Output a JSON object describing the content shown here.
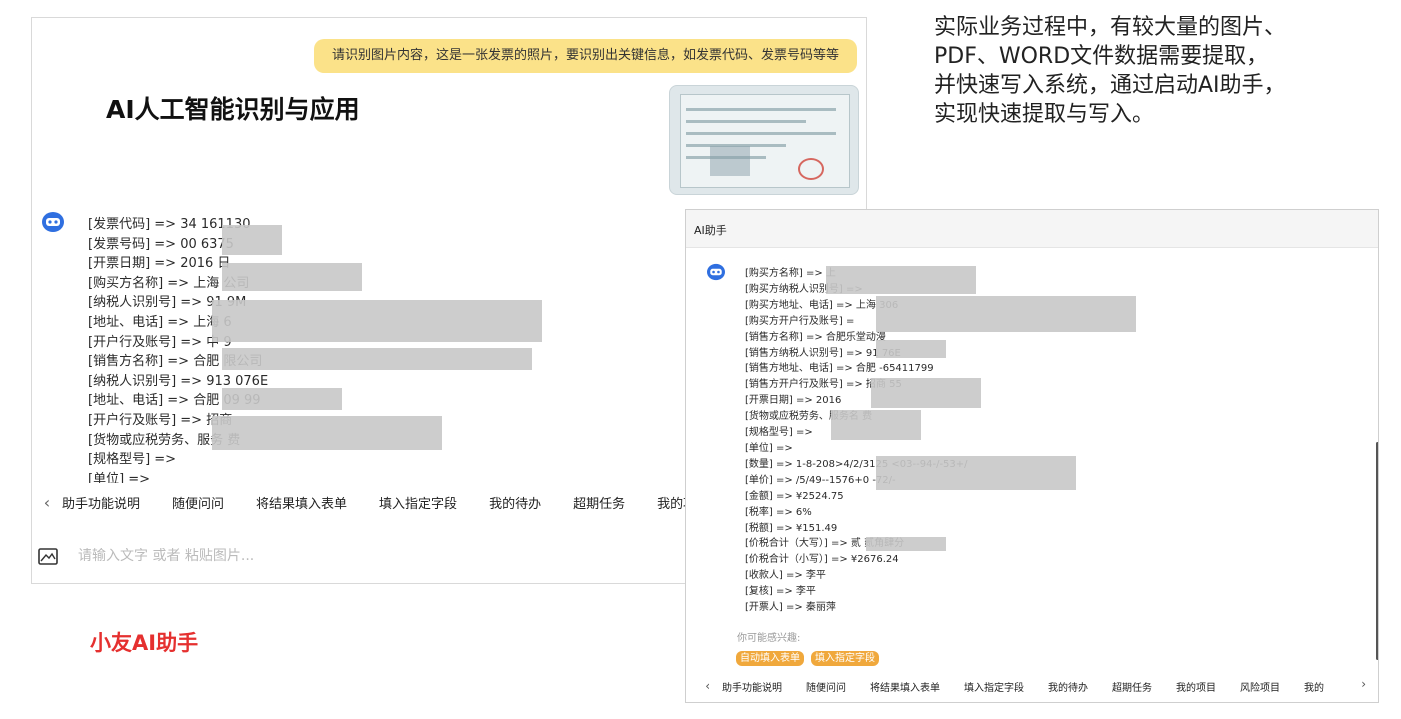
{
  "left_panel": {
    "user_message": "请识别图片内容，这是一张发票的照片，要识别出关键信息，如发票代码、发票号码等等",
    "title": "AI人工智能识别与应用",
    "avatar_icon": "robot-avatar-icon",
    "result_lines": [
      "[发票代码] => 34  161130",
      "[发票号码] => 00      6375",
      "[开票日期] => 2016         日",
      "[购买方名称] => 上海                         公司",
      "[纳税人识别号] => 91                          9M",
      "[地址、电话] => 上海                                                  6",
      "[开户行及账号] => 中                                                     9",
      "[销售方名称] => 合肥                        限公司",
      "[纳税人识别号] => 913                  076E",
      "[地址、电话] => 合肥                          09          99",
      "[开户行及账号] => 招商",
      "[货物或应税劳务、服务                     费",
      "[规格型号] =>",
      "[单位] =>"
    ],
    "chips": [
      "助手功能说明",
      "随便问问",
      "将结果填入表单",
      "填入指定字段",
      "我的待办",
      "超期任务",
      "我的项目"
    ],
    "input_placeholder": "请输入文字 或者 粘贴图片...",
    "caption": "小友AI助手"
  },
  "description": {
    "lines": [
      "实际业务过程中，有较大量的图片、",
      "PDF、WORD文件数据需要提取，",
      "并快速写入系统，通过启动AI助手，",
      "实现快速提取与写入。"
    ]
  },
  "right_panel": {
    "title": "AI助手",
    "avatar_icon": "robot-avatar-icon",
    "result_lines": [
      "[购买方名称] => 上",
      "[购买方纳税人识别号] =>",
      "[购买方地址、电话] => 上海                                                              306",
      "[购买方开户行及账号] =",
      "[销售方名称] => 合肥乐堂动漫",
      "[销售方纳税人识别号] => 91                            76E",
      "[销售方地址、电话] => 合肥                                    -65411799",
      "[销售方开户行及账号] => 招商                             55",
      "[开票日期] => 2016",
      "[货物或应税劳务、服务名                    费",
      "[规格型号] =>",
      "[单位] =>",
      "[数量] => 1-8-208>4/2/3125                                   <03--94-/-53+/",
      "[单价] => /5/49--1576+0                                         -72/-",
      "[金额] => ¥2524.75",
      "[税率] => 6%",
      "[税额] => ¥151.49",
      "[价税合计（大写）] => 贰                    贰角肆分",
      "[价税合计（小写）] => ¥2676.24",
      "[收款人] => 李平",
      "[复核] => 李平",
      "[开票人] => 秦丽萍"
    ],
    "interest_label": "你可能感兴趣:",
    "suggestions": [
      "自动填入表单",
      "填入指定字段"
    ],
    "chips": [
      "助手功能说明",
      "随便问问",
      "将结果填入表单",
      "填入指定字段",
      "我的待办",
      "超期任务",
      "我的项目",
      "风险项目",
      "我的"
    ]
  },
  "colors": {
    "user_bubble": "#fbe289",
    "caption_red": "#e5302f",
    "suggestion_orange": "#f0a83c",
    "avatar_blue": "#2f6fe0"
  }
}
